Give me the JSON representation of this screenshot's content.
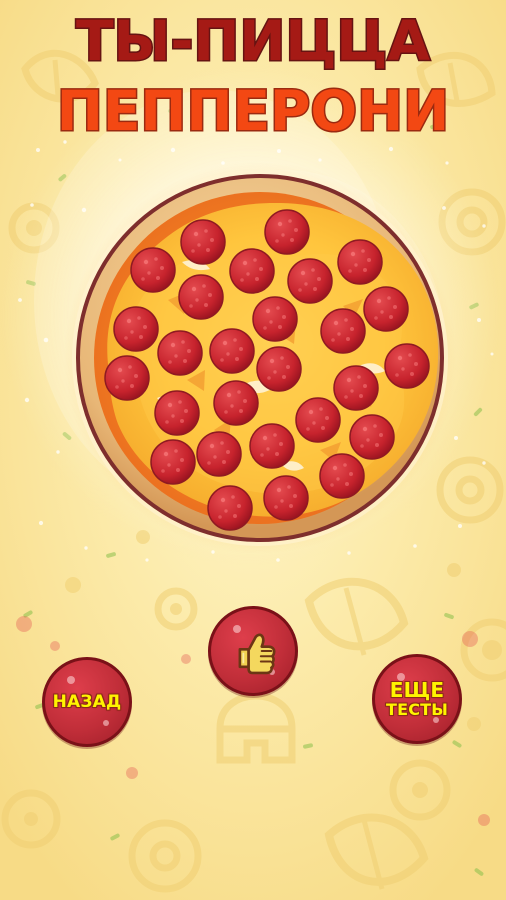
{
  "title": {
    "line1": "ТЫ-ПИЦЦА",
    "line2": "ПЕППЕРОНИ"
  },
  "buttons": {
    "back": {
      "label": "НАЗАД"
    },
    "like": {
      "icon": "thumbs-up-icon"
    },
    "more": {
      "label_line1": "ЕЩЕ",
      "label_line2": "ТЕСТЫ"
    }
  },
  "colors": {
    "background": "#fbe89c",
    "title_dark": "#a51a15",
    "title_orange": "#f34813",
    "button_red": "#c12e39",
    "button_text": "#fff400",
    "pepperoni": "#c7232d"
  }
}
